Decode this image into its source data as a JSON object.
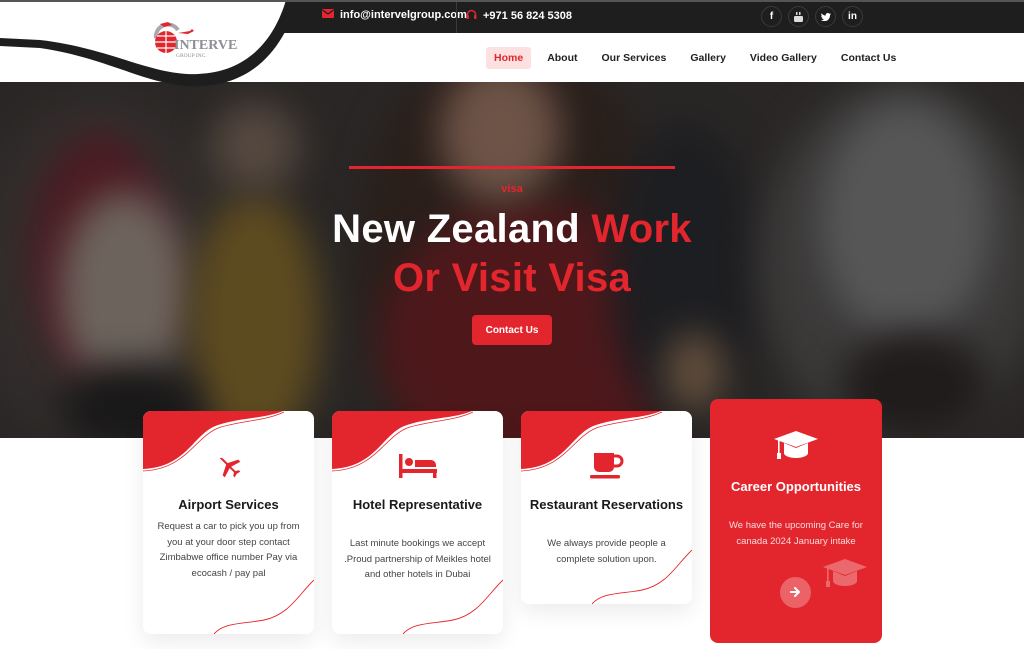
{
  "brand": {
    "name": "INTERVEL",
    "subtitle": "GROUP INC.",
    "accent_color": "#e3262d",
    "dark_color": "#1e1e1e"
  },
  "topbar": {
    "email": "info@intervelgroup.com",
    "email_icon": "envelope-icon",
    "phone": "+971 56 824 5308",
    "phone_icon": "headset-icon",
    "social": [
      {
        "name": "facebook",
        "glyph": "f"
      },
      {
        "name": "youtube",
        "glyph": "▶"
      },
      {
        "name": "twitter",
        "glyph": "t"
      },
      {
        "name": "linkedin",
        "glyph": "in"
      }
    ]
  },
  "nav": {
    "items": [
      {
        "label": "Home",
        "active": true
      },
      {
        "label": "About",
        "active": false
      },
      {
        "label": "Our Services",
        "active": false
      },
      {
        "label": "Gallery",
        "active": false
      },
      {
        "label": "Video Gallery",
        "active": false
      },
      {
        "label": "Contact Us",
        "active": false
      }
    ]
  },
  "hero": {
    "kicker": "visa",
    "title_white": "New Zealand ",
    "title_red_1": "Work",
    "title_red_2": "Or Visit Visa",
    "button_label": "Contact Us"
  },
  "cards": [
    {
      "icon": "plane-icon",
      "title": "Airport Services",
      "text": "Request a car to pick you up from you at your door step contact Zimbabwe office number Pay via ecocash / pay pal"
    },
    {
      "icon": "bed-icon",
      "title": "Hotel Representative",
      "text": "Last minute bookings we accept .Proud partnership of Meikles hotel and other hotels in Dubai"
    },
    {
      "icon": "coffee-cup-icon",
      "title": "Restaurant Reservations",
      "text": "We always provide people a complete solution upon."
    },
    {
      "icon": "graduation-cap-icon",
      "title": "Career Opportunities",
      "text": "We have the upcoming Care for canada 2024 January intake",
      "button_icon": "arrow-right-icon"
    }
  ]
}
